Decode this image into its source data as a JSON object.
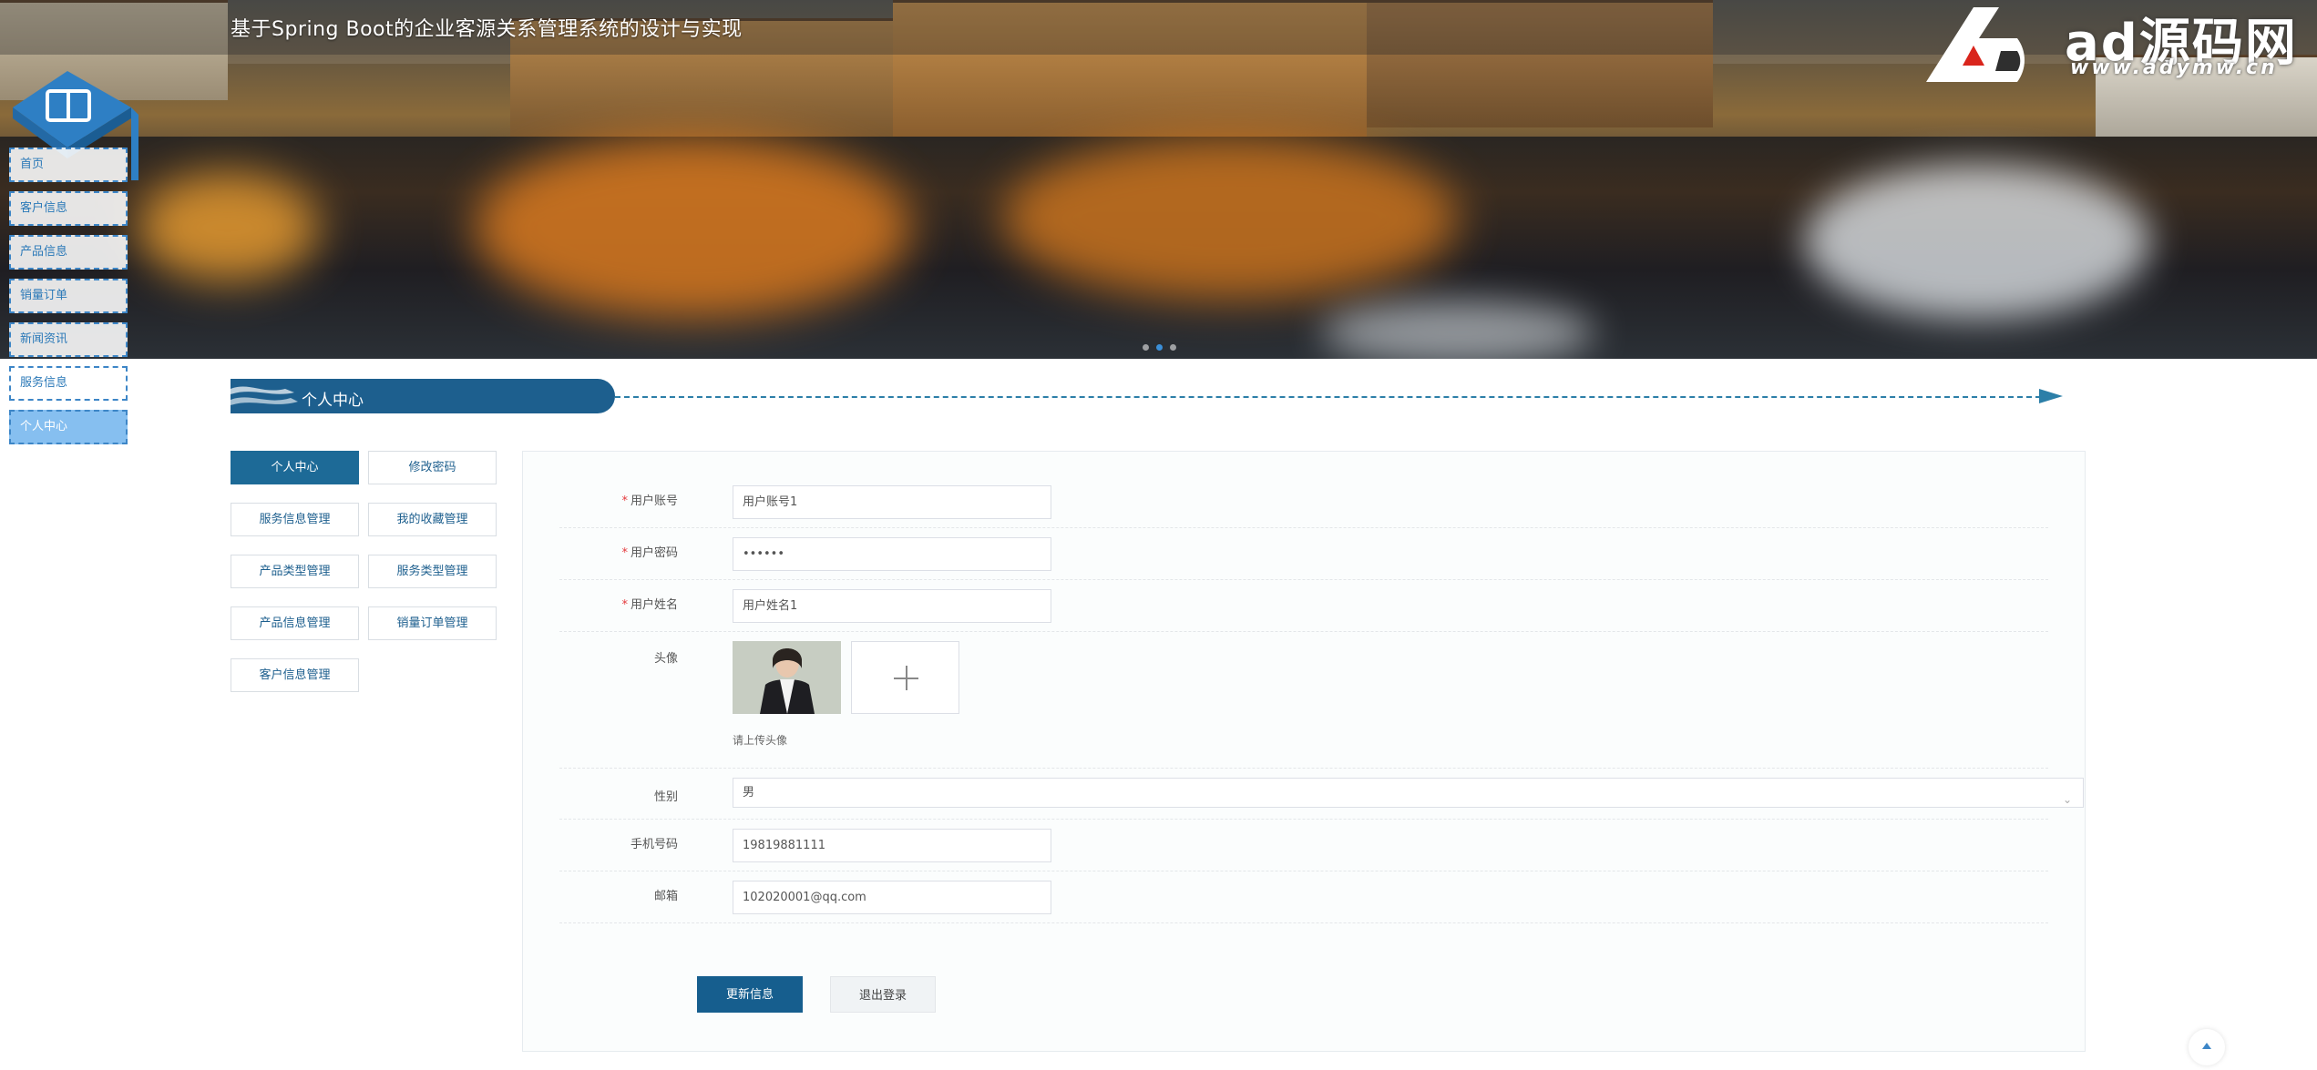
{
  "header": {
    "title": "基于Spring Boot的企业客源关系管理系统的设计与实现",
    "watermark_text": "ad源码网",
    "watermark_url": "www.adymw.cn"
  },
  "nav": {
    "items": [
      {
        "label": "首页"
      },
      {
        "label": "客户信息"
      },
      {
        "label": "产品信息"
      },
      {
        "label": "销量订单"
      },
      {
        "label": "新闻资讯"
      },
      {
        "label": "服务信息"
      },
      {
        "label": "个人中心"
      }
    ],
    "active_index": 6
  },
  "section": {
    "title": "个人中心"
  },
  "menu": {
    "items": [
      {
        "label": "个人中心"
      },
      {
        "label": "修改密码"
      },
      {
        "label": "服务信息管理"
      },
      {
        "label": "我的收藏管理"
      },
      {
        "label": "产品类型管理"
      },
      {
        "label": "服务类型管理"
      },
      {
        "label": "产品信息管理"
      },
      {
        "label": "销量订单管理"
      },
      {
        "label": "客户信息管理"
      }
    ],
    "active_index": 0
  },
  "form": {
    "account": {
      "label": "用户账号",
      "value": "用户账号1"
    },
    "password": {
      "label": "用户密码",
      "value": "••••••"
    },
    "name": {
      "label": "用户姓名",
      "value": "用户姓名1"
    },
    "avatar": {
      "label": "头像",
      "hint": "请上传头像"
    },
    "gender": {
      "label": "性别",
      "value": "男"
    },
    "phone": {
      "label": "手机号码",
      "value": "19819881111"
    },
    "email": {
      "label": "邮箱",
      "value": "102020001@qq.com"
    },
    "required_mark": "*"
  },
  "actions": {
    "update": "更新信息",
    "logout": "退出登录"
  },
  "colors": {
    "primary": "#165e8e",
    "nav_border": "#3d86c7",
    "nav_active": "#86bff0",
    "required": "#e4393c"
  },
  "icons": {
    "logo": "book-icon",
    "upload": "plus-icon",
    "select": "chevron-down-icon",
    "back_top": "caret-up-icon"
  }
}
